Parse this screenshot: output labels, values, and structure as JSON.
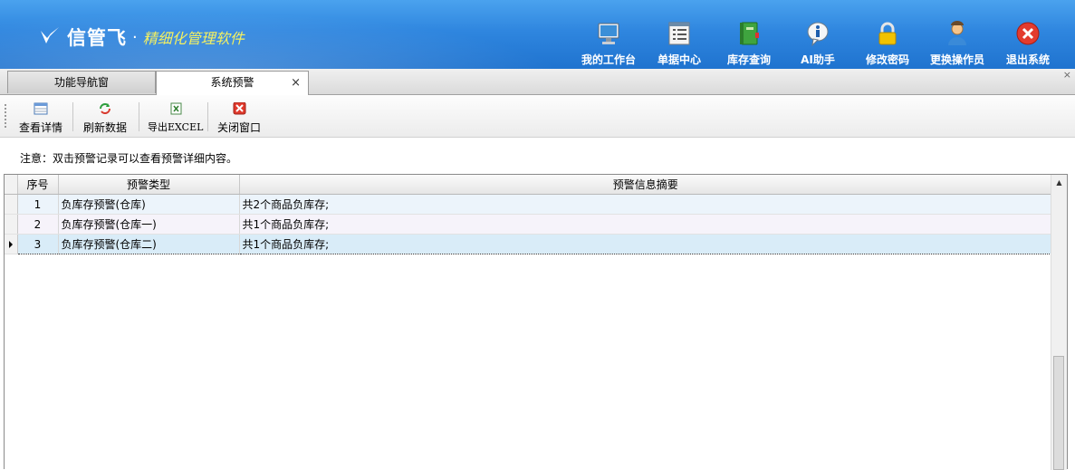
{
  "header": {
    "brand": "信管飞",
    "separator": "·",
    "slogan": "精细化管理软件",
    "nav": [
      {
        "label": "我的工作台",
        "icon": "monitor-icon"
      },
      {
        "label": "单据中心",
        "icon": "document-list-icon"
      },
      {
        "label": "库存查询",
        "icon": "inventory-book-icon"
      },
      {
        "label": "AI助手",
        "icon": "info-bubble-icon"
      },
      {
        "label": "修改密码",
        "icon": "lock-icon"
      },
      {
        "label": "更换操作员",
        "icon": "user-icon"
      },
      {
        "label": "退出系统",
        "icon": "close-circle-icon"
      }
    ]
  },
  "tabs": [
    {
      "label": "功能导航窗",
      "active": false
    },
    {
      "label": "系统预警",
      "active": true,
      "close": "×"
    }
  ],
  "window_close": "×",
  "toolbar": {
    "view_detail": "查看详情",
    "refresh": "刷新数据",
    "export": "导出EXCEL",
    "close_window": "关闭窗口"
  },
  "notice": "注意：双击预警记录可以查看预警详细内容。",
  "grid": {
    "columns": [
      "序号",
      "预警类型",
      "预警信息摘要"
    ],
    "rows": [
      {
        "no": "1",
        "type": "负库存预警(仓库)",
        "summary": "共2个商品负库存;"
      },
      {
        "no": "2",
        "type": "负库存预警(仓库一)",
        "summary": "共1个商品负库存;"
      },
      {
        "no": "3",
        "type": "负库存预警(仓库二)",
        "summary": "共1个商品负库存;"
      }
    ],
    "selected_row": 3
  },
  "colors": {
    "header_blue": "#2f86df",
    "slogan_yellow": "#f4f060",
    "selected_row": "#d9ecf8"
  }
}
